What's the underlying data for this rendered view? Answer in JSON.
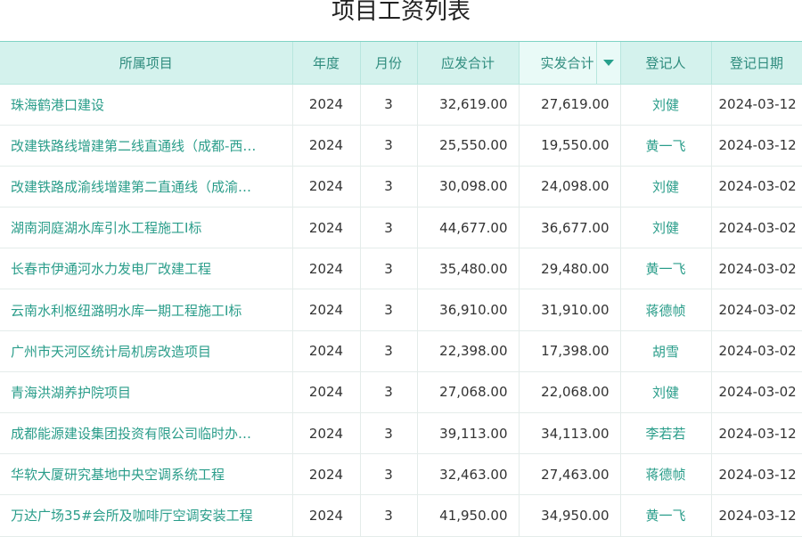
{
  "page": {
    "title": "项目工资列表"
  },
  "table": {
    "headers": {
      "project": "所属项目",
      "year": "年度",
      "month": "月份",
      "payable": "应发合计",
      "actual": "实发合计",
      "registrar": "登记人",
      "date": "登记日期"
    },
    "sorted_column": "actual",
    "rows": [
      {
        "project": "珠海鹤港口建设",
        "year": "2024",
        "month": "3",
        "payable": "32,619.00",
        "actual": "27,619.00",
        "registrar": "刘健",
        "date": "2024-03-12"
      },
      {
        "project": "改建铁路线增建第二线直通线（成都-西…",
        "year": "2024",
        "month": "3",
        "payable": "25,550.00",
        "actual": "19,550.00",
        "registrar": "黄一飞",
        "date": "2024-03-12"
      },
      {
        "project": "改建铁路成渝线增建第二直通线（成渝…",
        "year": "2024",
        "month": "3",
        "payable": "30,098.00",
        "actual": "24,098.00",
        "registrar": "刘健",
        "date": "2024-03-02"
      },
      {
        "project": "湖南洞庭湖水库引水工程施工Ⅰ标",
        "year": "2024",
        "month": "3",
        "payable": "44,677.00",
        "actual": "36,677.00",
        "registrar": "刘健",
        "date": "2024-03-02"
      },
      {
        "project": "长春市伊通河水力发电厂改建工程",
        "year": "2024",
        "month": "3",
        "payable": "35,480.00",
        "actual": "29,480.00",
        "registrar": "黄一飞",
        "date": "2024-03-02"
      },
      {
        "project": "云南水利枢纽潞明水库一期工程施工Ⅰ标",
        "year": "2024",
        "month": "3",
        "payable": "36,910.00",
        "actual": "31,910.00",
        "registrar": "蒋德帧",
        "date": "2024-03-02"
      },
      {
        "project": "广州市天河区统计局机房改造项目",
        "year": "2024",
        "month": "3",
        "payable": "22,398.00",
        "actual": "17,398.00",
        "registrar": "胡雪",
        "date": "2024-03-02"
      },
      {
        "project": "青海洪湖养护院项目",
        "year": "2024",
        "month": "3",
        "payable": "27,068.00",
        "actual": "22,068.00",
        "registrar": "刘健",
        "date": "2024-03-02"
      },
      {
        "project": "成都能源建设集团投资有限公司临时办…",
        "year": "2024",
        "month": "3",
        "payable": "39,113.00",
        "actual": "34,113.00",
        "registrar": "李若若",
        "date": "2024-03-12"
      },
      {
        "project": "华软大厦研究基地中央空调系统工程",
        "year": "2024",
        "month": "3",
        "payable": "32,463.00",
        "actual": "27,463.00",
        "registrar": "蒋德帧",
        "date": "2024-03-12"
      },
      {
        "project": "万达广场35#会所及咖啡厅空调安装工程",
        "year": "2024",
        "month": "3",
        "payable": "41,950.00",
        "actual": "34,950.00",
        "registrar": "黄一飞",
        "date": "2024-03-12"
      }
    ]
  },
  "colors": {
    "header_bg": "#d4f2ed",
    "accent": "#2a9d8a",
    "sort_icon": "#27a08c"
  },
  "icons": {
    "sort": "caret-down-icon"
  }
}
